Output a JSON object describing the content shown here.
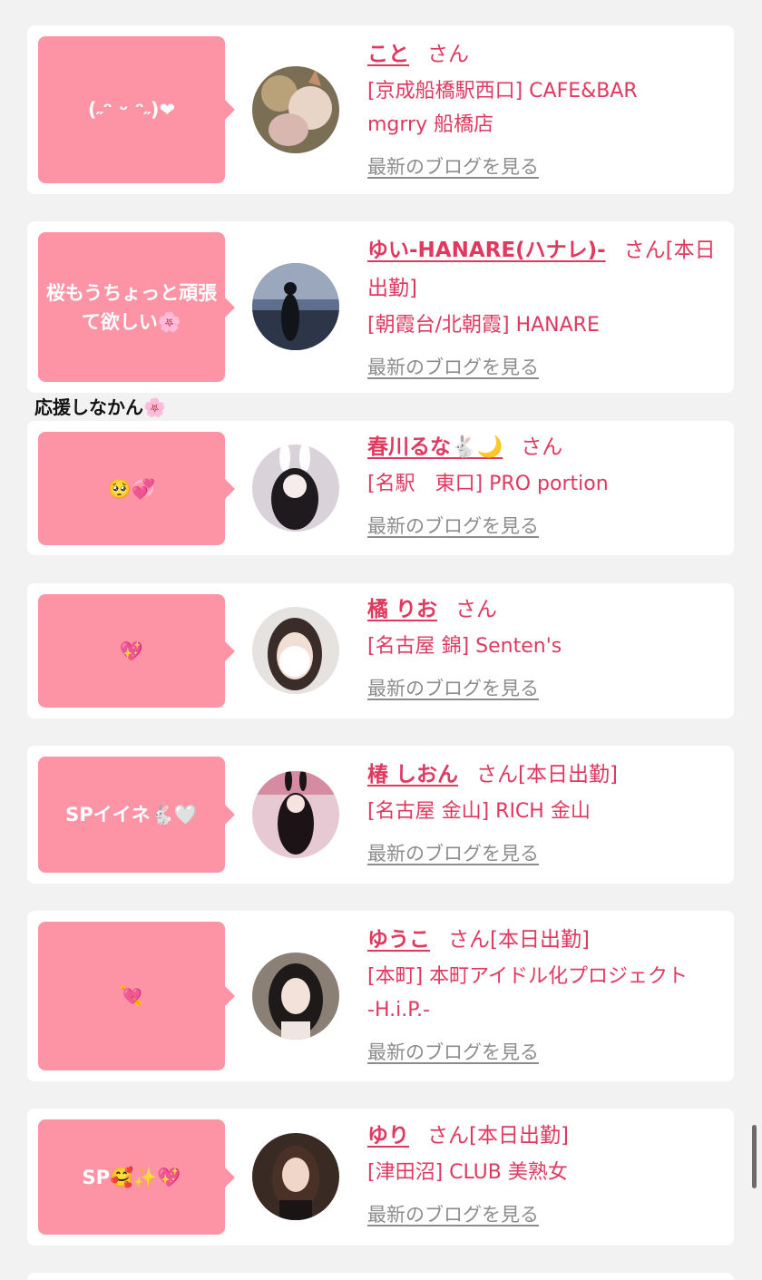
{
  "blog_link_label": "最新のブログを見る",
  "honorific": "さん",
  "annotation": "応援しなかん🌸",
  "colors": {
    "accent": "#e0395f",
    "bubble": "#fd94a6",
    "background": "#f2f2f3"
  },
  "entries": [
    {
      "message": "(˶ᵔ ᵕ ᵔ˶)❤",
      "name": "こと",
      "status": "",
      "shop_line1": "[京成船橋駅西口] CAFE&BAR",
      "shop_line2": "mgrry 船橋店"
    },
    {
      "message": "桜もうちょっと頑張て欲しい🌸",
      "name": "ゆい-HANARE(ハナレ)-",
      "status": "[本日出勤]",
      "shop_line1": "[朝霞台/北朝霞] HANARE",
      "shop_line2": ""
    },
    {
      "message": "🥺💞",
      "name": "春川るな🐇🌙",
      "status": "",
      "shop_line1": "[名駅　東口] PRO portion",
      "shop_line2": ""
    },
    {
      "message": "💖",
      "name": "橘 りお",
      "status": "",
      "shop_line1": "[名古屋 錦] Senten's",
      "shop_line2": ""
    },
    {
      "message": "SPイイネ🐇🤍",
      "name": "椿 しおん",
      "status": "[本日出勤]",
      "shop_line1": "[名古屋 金山] RICH 金山",
      "shop_line2": ""
    },
    {
      "message": "💘",
      "name": "ゆうこ",
      "status": "[本日出勤]",
      "shop_line1": "[本町] 本町アイドル化プロジェクト",
      "shop_line2": "-H.i.P.-"
    },
    {
      "message": "SP🥰✨💖",
      "name": "ゆり",
      "status": "[本日出勤]",
      "shop_line1": "[津田沼] CLUB 美熟女",
      "shop_line2": ""
    }
  ]
}
